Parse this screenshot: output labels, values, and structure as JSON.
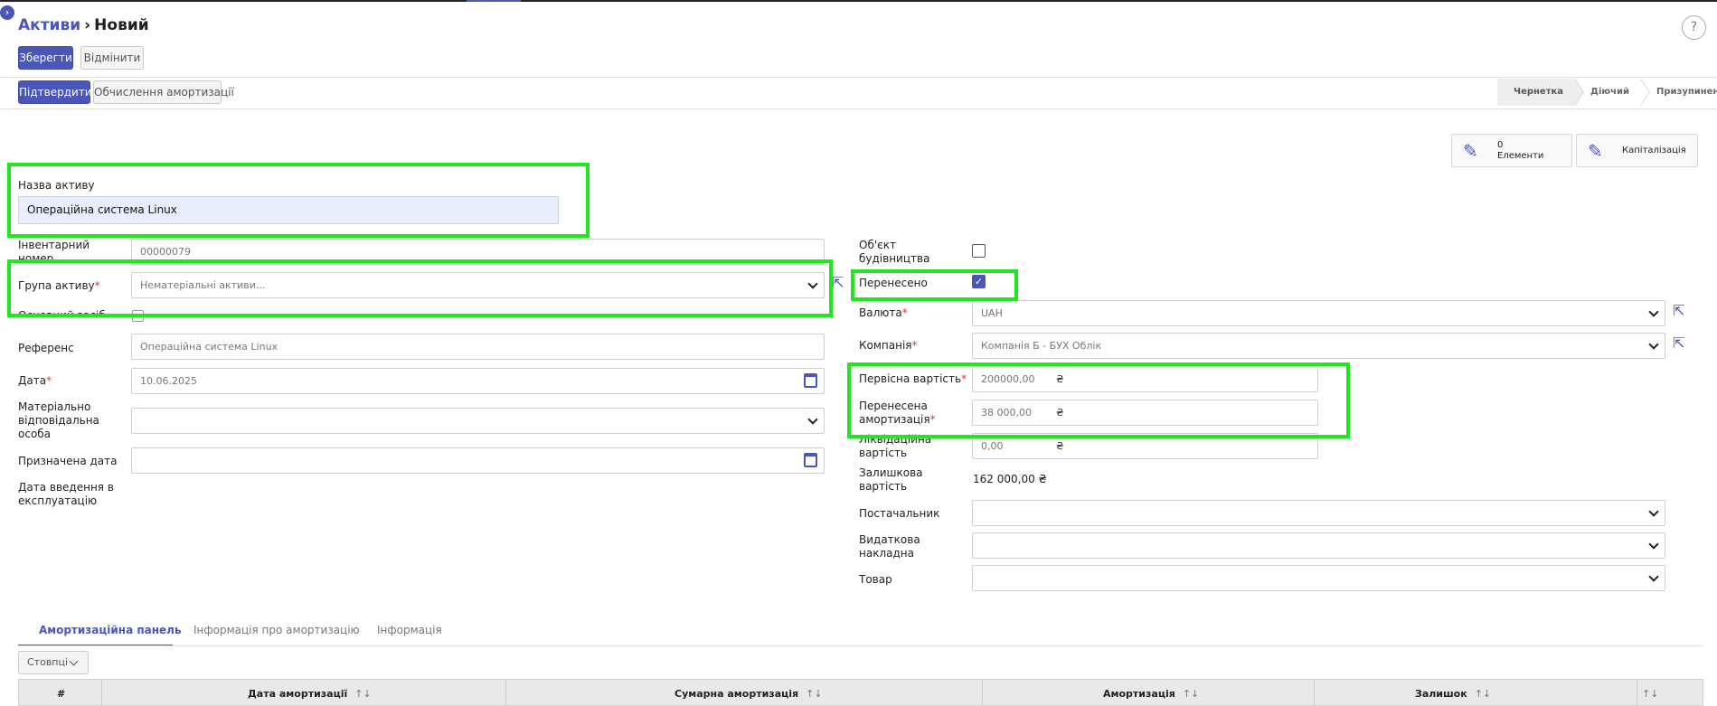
{
  "breadcrumb": {
    "parent": "Активи",
    "current": "Новий"
  },
  "help_label": "?",
  "toolbar": {
    "save_label": "Зберегти",
    "discard_label": "Відмінити"
  },
  "actions": {
    "confirm_label": "Підтвердити",
    "depreciation_label": "Обчислення амортизації"
  },
  "status_steps": [
    "Чернетка",
    "Діючий",
    "Призупинений"
  ],
  "status_active": "Чернетка",
  "smart_buttons": {
    "elements": {
      "count": "0",
      "label": "Елементи"
    },
    "capitalization": {
      "label": "Капіталізація"
    }
  },
  "form": {
    "asset_name": {
      "label": "Назва активу",
      "value": "Операційна система Linux"
    },
    "inventory_number": {
      "label": "Інвентарний номер",
      "value": "00000079"
    },
    "asset_group": {
      "label": "Група активу",
      "required_mark": "*",
      "placeholder": "Нематеріальні активи..."
    },
    "fixed_asset": {
      "label": "Основний засіб",
      "checked": false
    },
    "reference": {
      "label": "Референс",
      "value": "Операційна система Linux"
    },
    "date": {
      "label": "Дата",
      "required_mark": "*",
      "value": "10.06.2025"
    },
    "responsible_person": {
      "label": "Матеріально відповідальна особа",
      "value": ""
    },
    "assigned_date": {
      "label": "Призначена дата",
      "value": ""
    },
    "commissioning_date": {
      "label": "Дата введення в експлуатацію"
    },
    "construction_object": {
      "label": "Об'єкт будівництва",
      "checked": false
    },
    "transferred": {
      "label": "Перенесено",
      "checked": true
    },
    "currency": {
      "label": "Валюта",
      "required_mark": "*",
      "value": "UAH"
    },
    "company": {
      "label": "Компанія",
      "required_mark": "*",
      "value": "Компанія Б - БУХ Облік"
    },
    "initial_cost": {
      "label": "Первісна вартість",
      "required_mark": "*",
      "value": "200000,00",
      "currency": "₴"
    },
    "transferred_depreciation": {
      "label": "Перенесена амортизація",
      "required_mark": "*",
      "value": "38 000,00",
      "currency": "₴"
    },
    "liquidation_value": {
      "label": "Ліквідаційна вартість",
      "value": "0,00",
      "currency": "₴"
    },
    "residual_value": {
      "label": "Залишкова вартість",
      "value": "162 000,00 ₴"
    },
    "supplier": {
      "label": "Постачальник",
      "value": ""
    },
    "expense_invoice": {
      "label": "Видаткова накладна",
      "value": ""
    },
    "product": {
      "label": "Товар",
      "value": ""
    }
  },
  "tabs": [
    "Амортизаційна панель",
    "Інформація про амортизацію",
    "Інформація"
  ],
  "columns_button": "Стовпці",
  "table": {
    "columns": [
      "#",
      "Дата амортизації",
      "Сумарна амортизація",
      "Амортизація",
      "Залишок"
    ],
    "sort_glyph": "↑↓"
  },
  "colors": {
    "accent": "#4a56b8",
    "highlight_box": "#22e61f",
    "required": "#d9383a"
  },
  "icons": {
    "sidebar_toggle": "chevron-right-icon",
    "edit": "pencil-icon",
    "external_link": "external-link-icon",
    "dropdown": "chevron-down-icon",
    "calendar": "calendar-icon"
  }
}
